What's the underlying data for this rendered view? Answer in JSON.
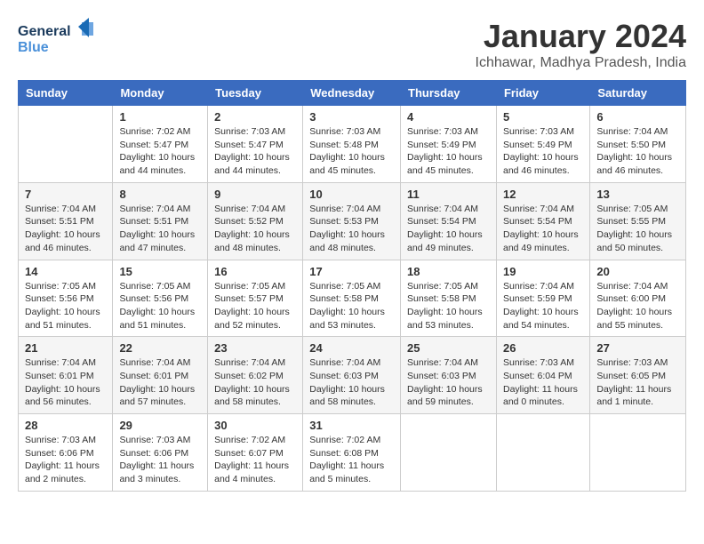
{
  "header": {
    "logo_general": "General",
    "logo_blue": "Blue",
    "title": "January 2024",
    "subtitle": "Ichhawar, Madhya Pradesh, India"
  },
  "days_of_week": [
    "Sunday",
    "Monday",
    "Tuesday",
    "Wednesday",
    "Thursday",
    "Friday",
    "Saturday"
  ],
  "weeks": [
    [
      {
        "day": "",
        "info": ""
      },
      {
        "day": "1",
        "info": "Sunrise: 7:02 AM\nSunset: 5:47 PM\nDaylight: 10 hours\nand 44 minutes."
      },
      {
        "day": "2",
        "info": "Sunrise: 7:03 AM\nSunset: 5:47 PM\nDaylight: 10 hours\nand 44 minutes."
      },
      {
        "day": "3",
        "info": "Sunrise: 7:03 AM\nSunset: 5:48 PM\nDaylight: 10 hours\nand 45 minutes."
      },
      {
        "day": "4",
        "info": "Sunrise: 7:03 AM\nSunset: 5:49 PM\nDaylight: 10 hours\nand 45 minutes."
      },
      {
        "day": "5",
        "info": "Sunrise: 7:03 AM\nSunset: 5:49 PM\nDaylight: 10 hours\nand 46 minutes."
      },
      {
        "day": "6",
        "info": "Sunrise: 7:04 AM\nSunset: 5:50 PM\nDaylight: 10 hours\nand 46 minutes."
      }
    ],
    [
      {
        "day": "7",
        "info": "Sunrise: 7:04 AM\nSunset: 5:51 PM\nDaylight: 10 hours\nand 46 minutes."
      },
      {
        "day": "8",
        "info": "Sunrise: 7:04 AM\nSunset: 5:51 PM\nDaylight: 10 hours\nand 47 minutes."
      },
      {
        "day": "9",
        "info": "Sunrise: 7:04 AM\nSunset: 5:52 PM\nDaylight: 10 hours\nand 48 minutes."
      },
      {
        "day": "10",
        "info": "Sunrise: 7:04 AM\nSunset: 5:53 PM\nDaylight: 10 hours\nand 48 minutes."
      },
      {
        "day": "11",
        "info": "Sunrise: 7:04 AM\nSunset: 5:54 PM\nDaylight: 10 hours\nand 49 minutes."
      },
      {
        "day": "12",
        "info": "Sunrise: 7:04 AM\nSunset: 5:54 PM\nDaylight: 10 hours\nand 49 minutes."
      },
      {
        "day": "13",
        "info": "Sunrise: 7:05 AM\nSunset: 5:55 PM\nDaylight: 10 hours\nand 50 minutes."
      }
    ],
    [
      {
        "day": "14",
        "info": "Sunrise: 7:05 AM\nSunset: 5:56 PM\nDaylight: 10 hours\nand 51 minutes."
      },
      {
        "day": "15",
        "info": "Sunrise: 7:05 AM\nSunset: 5:56 PM\nDaylight: 10 hours\nand 51 minutes."
      },
      {
        "day": "16",
        "info": "Sunrise: 7:05 AM\nSunset: 5:57 PM\nDaylight: 10 hours\nand 52 minutes."
      },
      {
        "day": "17",
        "info": "Sunrise: 7:05 AM\nSunset: 5:58 PM\nDaylight: 10 hours\nand 53 minutes."
      },
      {
        "day": "18",
        "info": "Sunrise: 7:05 AM\nSunset: 5:58 PM\nDaylight: 10 hours\nand 53 minutes."
      },
      {
        "day": "19",
        "info": "Sunrise: 7:04 AM\nSunset: 5:59 PM\nDaylight: 10 hours\nand 54 minutes."
      },
      {
        "day": "20",
        "info": "Sunrise: 7:04 AM\nSunset: 6:00 PM\nDaylight: 10 hours\nand 55 minutes."
      }
    ],
    [
      {
        "day": "21",
        "info": "Sunrise: 7:04 AM\nSunset: 6:01 PM\nDaylight: 10 hours\nand 56 minutes."
      },
      {
        "day": "22",
        "info": "Sunrise: 7:04 AM\nSunset: 6:01 PM\nDaylight: 10 hours\nand 57 minutes."
      },
      {
        "day": "23",
        "info": "Sunrise: 7:04 AM\nSunset: 6:02 PM\nDaylight: 10 hours\nand 58 minutes."
      },
      {
        "day": "24",
        "info": "Sunrise: 7:04 AM\nSunset: 6:03 PM\nDaylight: 10 hours\nand 58 minutes."
      },
      {
        "day": "25",
        "info": "Sunrise: 7:04 AM\nSunset: 6:03 PM\nDaylight: 10 hours\nand 59 minutes."
      },
      {
        "day": "26",
        "info": "Sunrise: 7:03 AM\nSunset: 6:04 PM\nDaylight: 11 hours\nand 0 minutes."
      },
      {
        "day": "27",
        "info": "Sunrise: 7:03 AM\nSunset: 6:05 PM\nDaylight: 11 hours\nand 1 minute."
      }
    ],
    [
      {
        "day": "28",
        "info": "Sunrise: 7:03 AM\nSunset: 6:06 PM\nDaylight: 11 hours\nand 2 minutes."
      },
      {
        "day": "29",
        "info": "Sunrise: 7:03 AM\nSunset: 6:06 PM\nDaylight: 11 hours\nand 3 minutes."
      },
      {
        "day": "30",
        "info": "Sunrise: 7:02 AM\nSunset: 6:07 PM\nDaylight: 11 hours\nand 4 minutes."
      },
      {
        "day": "31",
        "info": "Sunrise: 7:02 AM\nSunset: 6:08 PM\nDaylight: 11 hours\nand 5 minutes."
      },
      {
        "day": "",
        "info": ""
      },
      {
        "day": "",
        "info": ""
      },
      {
        "day": "",
        "info": ""
      }
    ]
  ]
}
